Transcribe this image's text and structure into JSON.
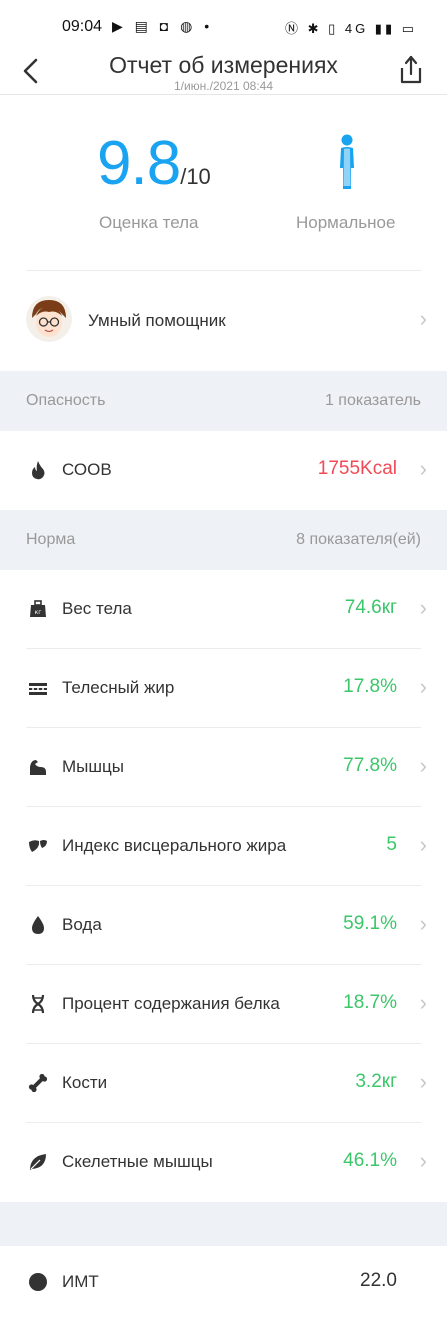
{
  "status_bar": {
    "time": "09:04",
    "left_icons": "▶ ▤ ◘ ◍ •",
    "right_icons": "Ⓝ ✱ ▯ 4G ▮▮ ▭"
  },
  "header": {
    "title": "Отчет об измерениях",
    "subtitle": "1/июн./2021 08:44"
  },
  "score": {
    "int": "9.",
    "dec": "8",
    "max": "/10",
    "label": "Оценка тела",
    "body_type": "Нормальное"
  },
  "assistant": {
    "label": "Умный помощник"
  },
  "danger": {
    "title": "Опасность",
    "count": "1 показатель",
    "items": [
      {
        "label": "СООВ",
        "value": "1755Kcal",
        "icon": "flame-icon"
      }
    ]
  },
  "normal": {
    "title": "Норма",
    "count": "8 показателя(ей)",
    "items": [
      {
        "label": "Вес тела",
        "value": "74.6кг",
        "icon": "weight-icon"
      },
      {
        "label": "Телесный жир",
        "value": "17.8%",
        "icon": "fat-icon"
      },
      {
        "label": "Мышцы",
        "value": "77.8%",
        "icon": "muscle-icon"
      },
      {
        "label": "Индекс висцерального жира",
        "value": "5",
        "icon": "visceral-fat-icon"
      },
      {
        "label": "Вода",
        "value": "59.1%",
        "icon": "water-drop-icon"
      },
      {
        "label": "Процент содержания белка",
        "value": "18.7%",
        "icon": "protein-dna-icon"
      },
      {
        "label": "Кости",
        "value": "3.2кг",
        "icon": "bone-icon"
      },
      {
        "label": "Скелетные мышцы",
        "value": "46.1%",
        "icon": "leaf-icon"
      }
    ]
  },
  "bottom_row": {
    "label": "ИМТ",
    "value": "22.0"
  },
  "colors": {
    "accent": "#1aa3f0",
    "good": "#3cc66a",
    "danger": "#f04a55",
    "section_bg": "#eef1f5"
  }
}
